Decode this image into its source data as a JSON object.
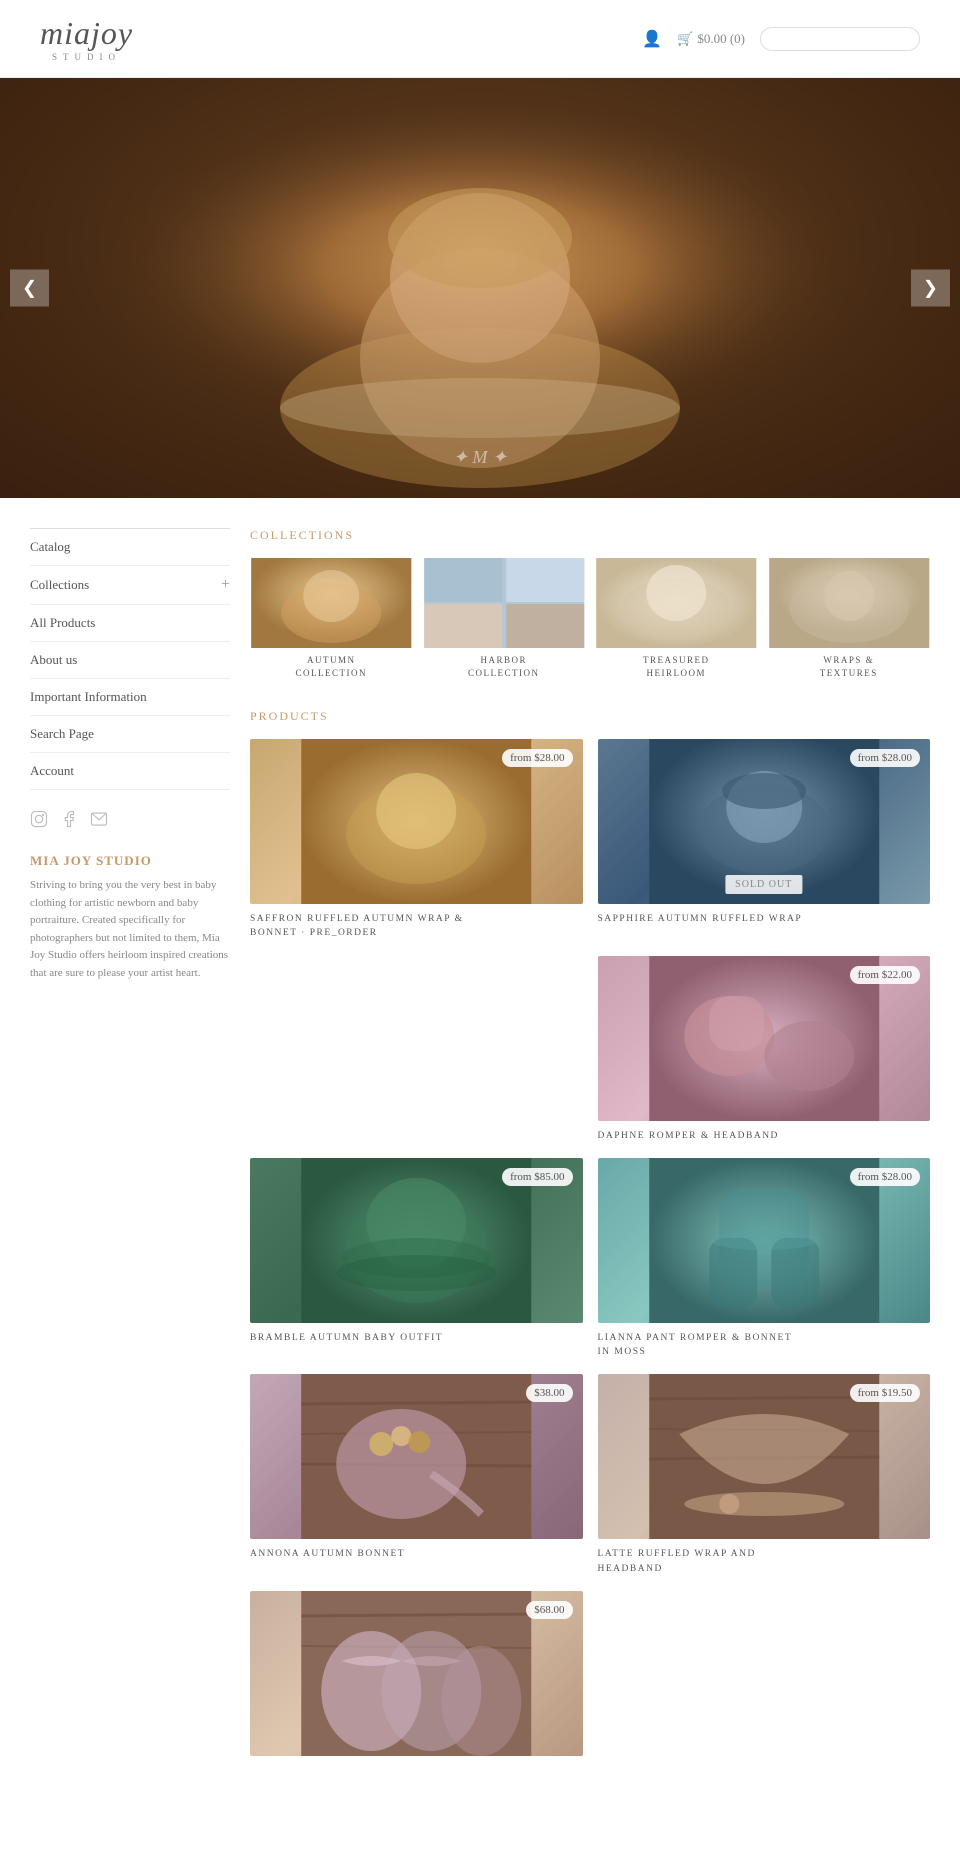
{
  "header": {
    "logo_main": "miajoy",
    "logo_sub": "STUDIO",
    "cart_icon": "🛒",
    "cart_label": "$0.00 (0)",
    "search_placeholder": ""
  },
  "hero": {
    "nav_left": "❮",
    "nav_right": "❯",
    "watermark": "✦ M ✦"
  },
  "sidebar": {
    "nav_items": [
      {
        "label": "Catalog",
        "has_plus": false
      },
      {
        "label": "Collections",
        "has_plus": true
      },
      {
        "label": "All Products",
        "has_plus": false
      },
      {
        "label": "About us",
        "has_plus": false
      },
      {
        "label": "Important Information",
        "has_plus": false
      },
      {
        "label": "Search Page",
        "has_plus": false
      },
      {
        "label": "Account",
        "has_plus": false
      }
    ],
    "social_icons": [
      "instagram",
      "facebook",
      "email"
    ],
    "brand_name": "MIA JOY STUDIO",
    "brand_desc": "Striving to bring you the very best in baby clothing for artistic newborn and baby portraiture. Created specifically for photographers but not limited to them, Mia Joy Studio offers heirloom inspired creations that are sure to please your artist heart."
  },
  "collections": {
    "section_title": "COLLECTIONS",
    "items": [
      {
        "name": "AUTUMN\nCOLLECTION",
        "color": "#c8a87a"
      },
      {
        "name": "HARBOR\nCOLLECTION",
        "color": "#a8c4d4"
      },
      {
        "name": "TREASURED\nHEIRLOOM",
        "color": "#e8dcc8"
      },
      {
        "name": "WRAPS &\nTEXTURES",
        "color": "#d4c8b8"
      }
    ]
  },
  "products": {
    "section_title": "PRODUCTS",
    "items": [
      {
        "name": "SAFFRON RUFFLED AUTUMN WRAP &\nBONNET · PRE_ORDER",
        "price": "from $28.00",
        "sold_out": false,
        "bg": 1
      },
      {
        "name": "SAPPHIRE AUTUMN RUFFLED WRAP",
        "price": "from $28.00",
        "sold_out": true,
        "bg": 2
      },
      {
        "name": "DAPHNE ROMPER & HEADBAND",
        "price": "from $22.00",
        "sold_out": false,
        "bg": 3,
        "single": true
      },
      {
        "name": "BRAMBLE AUTUMN BABY OUTFIT",
        "price": "from $85.00",
        "sold_out": false,
        "bg": 4
      },
      {
        "name": "LIANNA PANT ROMPER & BONNET\nIN MOSS",
        "price": "from $28.00",
        "sold_out": false,
        "bg": 5
      },
      {
        "name": "ANNONA AUTUMN BONNET",
        "price": "$38.00",
        "sold_out": false,
        "bg": 7
      },
      {
        "name": "LATTE RUFFLED WRAP AND\nHEADBAND",
        "price": "from $19.50",
        "sold_out": false,
        "bg": 8
      },
      {
        "name": "",
        "price": "$68.00",
        "sold_out": false,
        "bg": 9,
        "partial": true
      }
    ]
  }
}
